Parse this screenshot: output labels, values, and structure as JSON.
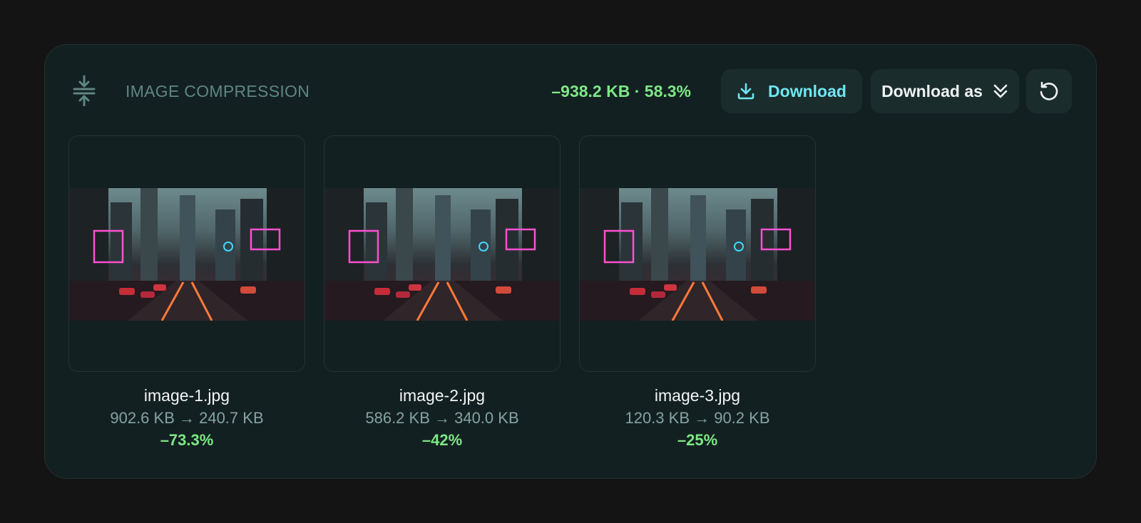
{
  "header": {
    "title": "IMAGE COMPRESSION",
    "savings": "–938.2 KB · 58.3%",
    "download_label": "Download",
    "download_as_label": "Download as"
  },
  "icons": {
    "compress": "compress-icon",
    "download": "download-icon",
    "download_as": "chevrons-down-icon",
    "reset": "rotate-ccw-icon"
  },
  "colors": {
    "accent_cyan": "#6ee7f2",
    "success_green": "#7ee787",
    "panel_bg": "#132021",
    "page_bg": "#141414"
  },
  "images": [
    {
      "name": "image-1.jpg",
      "sizes": "902.6 KB → 240.7 KB",
      "reduction": "–73.3%"
    },
    {
      "name": "image-2.jpg",
      "sizes": "586.2 KB → 340.0 KB",
      "reduction": "–42%"
    },
    {
      "name": "image-3.jpg",
      "sizes": "120.3 KB → 90.2 KB",
      "reduction": "–25%"
    }
  ]
}
